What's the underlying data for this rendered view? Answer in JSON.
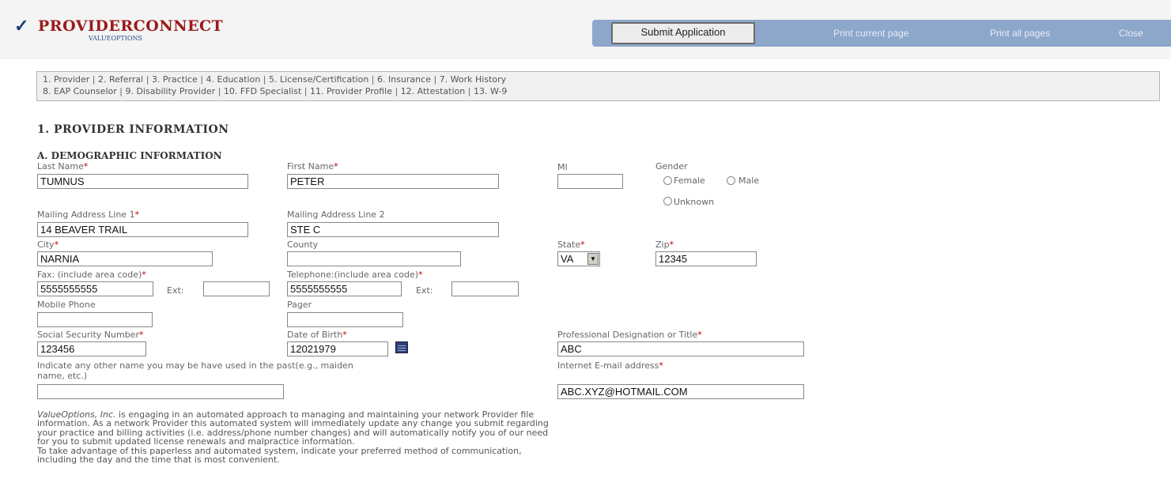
{
  "header": {
    "logo_main": "PROVIDERCONNECT",
    "logo_sub": "VALUEOPTIONS",
    "submit_label": "Submit Application",
    "print_current": "Print current page",
    "print_all": "Print all pages",
    "close": "Close"
  },
  "steps": {
    "row1": [
      "1. Provider",
      "2. Referral",
      "3. Practice",
      "4. Education",
      "5. License/Certification",
      "6. Insurance",
      "7. Work History"
    ],
    "row2": [
      "8. EAP Counselor",
      "9. Disability Provider",
      "10. FFD Specialist",
      "11. Provider Profile",
      "12. Attestation",
      "13. W-9"
    ],
    "separator": "|"
  },
  "section": {
    "title": "1. PROVIDER INFORMATION",
    "subtitle": "A. DEMOGRAPHIC INFORMATION"
  },
  "required_mark": "*",
  "fields": {
    "last_name": {
      "label": "Last Name",
      "value": "TUMNUS"
    },
    "first_name": {
      "label": "First Name",
      "value": "PETER"
    },
    "mi": {
      "label": "MI",
      "value": ""
    },
    "gender": {
      "label": "Gender",
      "options": [
        "Female",
        "Male",
        "Unknown"
      ]
    },
    "address1": {
      "label": "Mailing Address Line 1",
      "value": "14 BEAVER TRAIL"
    },
    "address2": {
      "label": "Mailing Address Line 2",
      "value": "STE C"
    },
    "city": {
      "label": "City",
      "value": "NARNIA"
    },
    "county": {
      "label": "County",
      "value": ""
    },
    "state": {
      "label": "State",
      "value": "VA"
    },
    "zip": {
      "label": "Zip",
      "value": "12345"
    },
    "fax": {
      "label": "Fax: (include area code)",
      "value": "5555555555",
      "ext_label": "Ext:",
      "ext_value": ""
    },
    "telephone": {
      "label": "Telephone:(include area code)",
      "value": "5555555555",
      "ext_label": "Ext:",
      "ext_value": ""
    },
    "mobile": {
      "label": "Mobile Phone",
      "value": ""
    },
    "pager": {
      "label": "Pager",
      "value": ""
    },
    "ssn": {
      "label": "Social Security Number",
      "value": "123456"
    },
    "dob": {
      "label": "Date of Birth",
      "value": "12021979"
    },
    "designation": {
      "label": "Professional Designation or Title",
      "value": "ABC"
    },
    "other_name": {
      "label_line1": "Indicate any other name you may be have used in the past(e.g., maiden",
      "label_line2": "name, etc.)",
      "value": ""
    },
    "email": {
      "label": "Internet E-mail address",
      "value": "ABC.XYZ@HOTMAIL.COM"
    }
  },
  "info": {
    "company": "ValueOptions, Inc.",
    "line1_rest": " is engaging in an automated approach to managing and maintaining your network Provider file",
    "line2": "information. As a network Provider this automated system will immediately update any change you submit regarding",
    "line3": "your practice and billing activities (i.e. address/phone number changes) and will automatically notify you of our need",
    "line4": "for you to submit updated license renewals and malpractice information.",
    "line5": "To take advantage of this paperless and automated system, indicate your preferred method of communication,",
    "line6": "including the day and the time that is most convenient."
  }
}
